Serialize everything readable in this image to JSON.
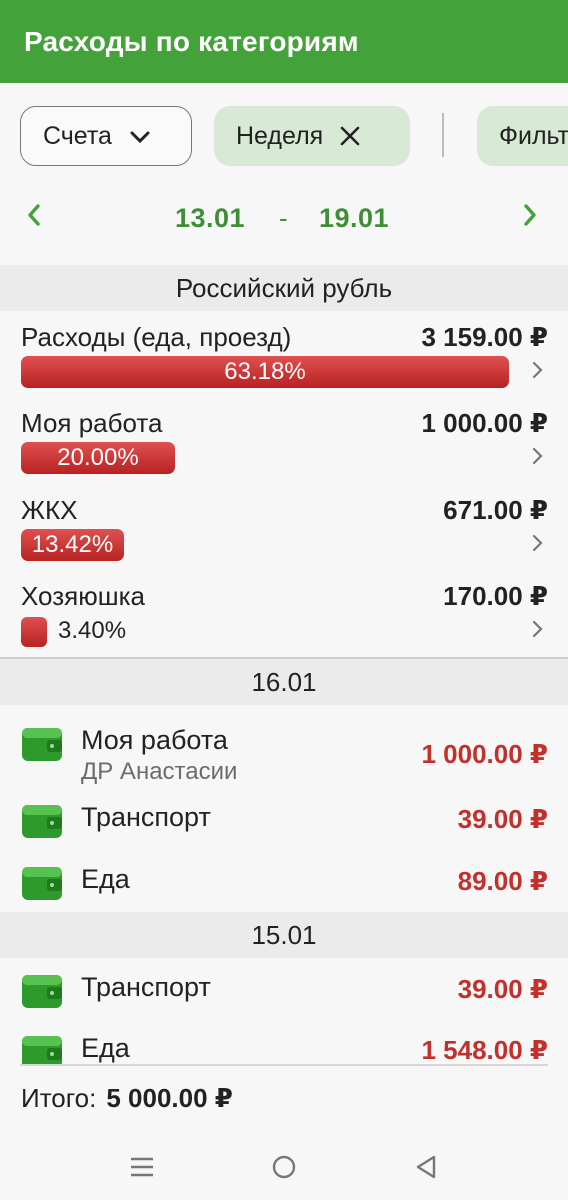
{
  "appbar": {
    "title": "Расходы по категориям"
  },
  "filters": {
    "accounts_label": "Счета",
    "period_label": "Неделя",
    "filter_label": "Фильтр"
  },
  "period": {
    "from": "13.01",
    "separator": "-",
    "to": "19.01"
  },
  "currency_header": "Российский рубль",
  "categories": [
    {
      "name": "Расходы (еда, проезд)",
      "amount": "3 159.00 ₽",
      "percent_label": "63.18%",
      "share": 63.18
    },
    {
      "name": "Моя работа",
      "amount": "1 000.00 ₽",
      "percent_label": "20.00%",
      "share": 20.0
    },
    {
      "name": "ЖКХ",
      "amount": "671.00 ₽",
      "percent_label": "13.42%",
      "share": 13.42
    },
    {
      "name": "Хозяюшка",
      "amount": "170.00 ₽",
      "percent_label": "3.40%",
      "share": 3.4
    }
  ],
  "days": [
    {
      "date": "16.01",
      "transactions": [
        {
          "category": "Моя работа",
          "note": "ДР Анастасии",
          "amount": "1 000.00 ₽"
        },
        {
          "category": "Транспорт",
          "note": "",
          "amount": "39.00 ₽"
        },
        {
          "category": "Еда",
          "note": "",
          "amount": "89.00 ₽"
        }
      ]
    },
    {
      "date": "15.01",
      "transactions": [
        {
          "category": "Транспорт",
          "note": "",
          "amount": "39.00 ₽"
        },
        {
          "category": "Еда",
          "note": "",
          "amount": "1 548.00 ₽"
        }
      ]
    }
  ],
  "total": {
    "label": "Итого:",
    "value": "5 000.00 ₽"
  },
  "colors": {
    "accent": "#43a23a",
    "expense": "#c2302c",
    "bar": "#d03a3a",
    "chip": "#d8ead5"
  },
  "icons": {
    "accounts_chevron": "chevron-down-icon",
    "clear_period": "close-icon",
    "prev_period": "chevron-left-icon",
    "next_period": "chevron-right-icon",
    "wallet": "wallet-icon",
    "nav": [
      "menu-icon",
      "home-circle-icon",
      "back-triangle-icon"
    ]
  }
}
